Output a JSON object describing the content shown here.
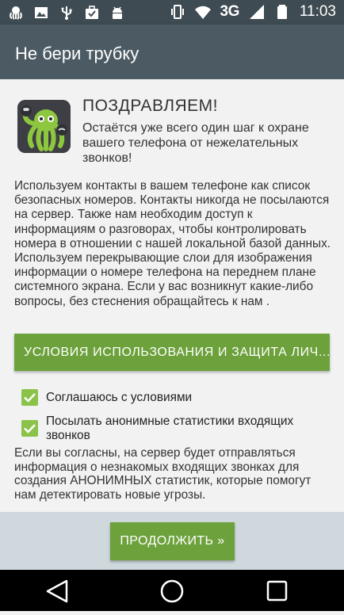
{
  "status_bar": {
    "network": "3G",
    "time": "11:03",
    "left_icons": [
      "octopus-icon",
      "image-icon",
      "usb-icon",
      "briefcase-check-icon",
      "android-icon"
    ],
    "right_icons": [
      "vibrate-icon",
      "wifi-icon",
      "signal-icon",
      "battery-icon"
    ]
  },
  "app_bar": {
    "title": "Не бери трубку"
  },
  "header": {
    "title": "ПОЗДРАВЛЯЕМ!",
    "subtitle": "Остаётся уже всего один шаг к охране вашего телефона от нежелательных звонков!"
  },
  "body": {
    "text": "Используем контакты в вашем телефоне как список безопасных номеров. Контакты никогда не посылаются на сервер. Также нам необходим доступ к информациям о разговорах, чтобы контролировать номера в отношении с нашей локальной базой данных. Используем перекрывающие слои для изображения информации о номере телефона на переднем плане системного экрана. Если у вас возникнут какие-либо вопросы, без стеснения обращайтесь к нам ."
  },
  "terms_button": {
    "label": "УСЛОВИЯ ИСПОЛЬЗОВАНИЯ И ЗАЩИТА ЛИЧ..."
  },
  "checkboxes": [
    {
      "label": "Соглашаюсь с условиями",
      "checked": true
    },
    {
      "label": "Посылать анонимные статистики входящих звонков",
      "checked": true
    }
  ],
  "notice": {
    "text": "Если вы согласны, на сервер будет отправляться информация о незнакомых входящих звонках для создания АНОНИМНЫХ статистик, которые помогут нам детектировать новые угрозы."
  },
  "continue_button": {
    "label": "ПРОДОЛЖИТЬ »"
  },
  "nav_bar": {
    "buttons": [
      "back-icon",
      "home-icon",
      "recents-icon"
    ]
  },
  "colors": {
    "status_bar": "#3f4b52",
    "app_bar": "#4c5b63",
    "background": "#f2f2f2",
    "accent_green": "#6ca13b",
    "checkbox_green": "#8bc34a",
    "footer": "#cfd8dd"
  }
}
